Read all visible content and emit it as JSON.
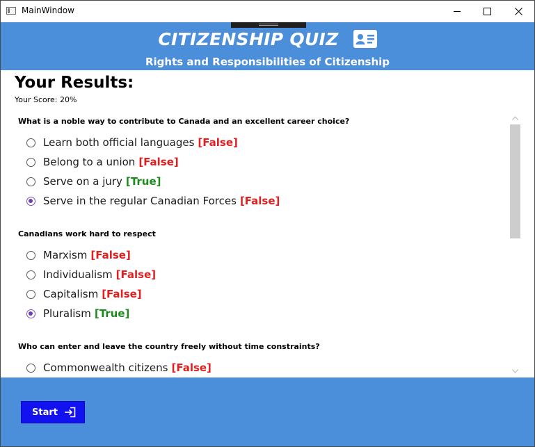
{
  "window": {
    "title": "MainWindow",
    "controls": [
      "minimize-icon",
      "maximize-icon",
      "close-icon"
    ]
  },
  "header": {
    "title": "CITIZENSHIP QUIZ",
    "icon": "id-card-icon",
    "subtitle": "Rights and Responsibilities of Citizenship",
    "background": "#4b8ed9"
  },
  "results": {
    "heading": "Your Results:",
    "score": "Your Score: 20%"
  },
  "questions": [
    {
      "text": "What is a noble way to contribute to Canada and an excellent career choice?",
      "options": [
        {
          "label": "Learn both official languages",
          "result": "[False]",
          "selected": false,
          "correct": false
        },
        {
          "label": "Belong to a union",
          "result": "[False]",
          "selected": false,
          "correct": false
        },
        {
          "label": "Serve on a jury",
          "result": "[True]",
          "selected": false,
          "correct": true
        },
        {
          "label": "Serve in the regular Canadian Forces",
          "result": "[False]",
          "selected": true,
          "correct": false
        }
      ]
    },
    {
      "text": "Canadians work hard to respect",
      "options": [
        {
          "label": "Marxism",
          "result": "[False]",
          "selected": false,
          "correct": false
        },
        {
          "label": "Individualism",
          "result": "[False]",
          "selected": false,
          "correct": false
        },
        {
          "label": "Capitalism",
          "result": "[False]",
          "selected": false,
          "correct": false
        },
        {
          "label": "Pluralism",
          "result": "[True]",
          "selected": true,
          "correct": true
        }
      ]
    },
    {
      "text": "Who can enter and leave the country freely without time constraints?",
      "options": [
        {
          "label": "Commonwealth citizens",
          "result": "[False]",
          "selected": false,
          "correct": false
        }
      ]
    }
  ],
  "colors": {
    "false": "#e02020",
    "true": "#1d8a1d",
    "selected_radio": "#6a3db3",
    "start_button": "#1212f0"
  },
  "footer": {
    "start_label": "Start",
    "start_icon": "sign-in-icon"
  }
}
